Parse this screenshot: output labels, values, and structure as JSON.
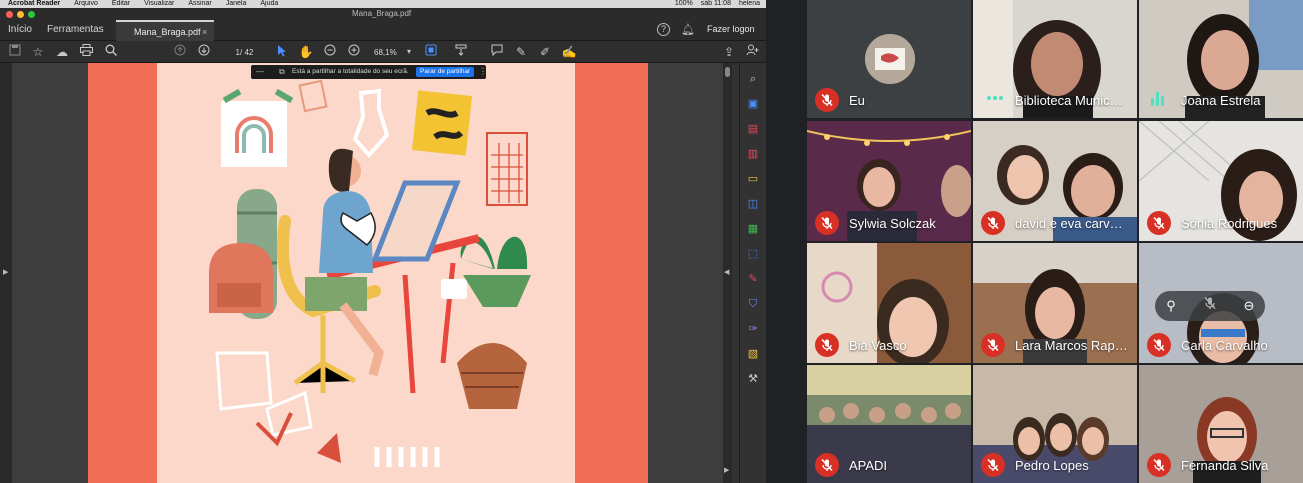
{
  "menubar": {
    "app": "Acrobat Reader",
    "items": [
      "Arquivo",
      "Editar",
      "Visualizar",
      "Assinar",
      "Janela",
      "Ajuda"
    ],
    "battery": "100%",
    "clock": "sáb 11:08",
    "user": "helena"
  },
  "window": {
    "title": "Mana_Braga.pdf",
    "nav_home": "Início",
    "nav_tools": "Ferramentas",
    "tab_label": "Mana_Braga.pdf",
    "tab_close": "×",
    "help_label": "?",
    "login_label": "Fazer logon"
  },
  "toolbar": {
    "page_current": "1",
    "page_total": "/ 42",
    "zoom": "68,1%"
  },
  "share_bar": {
    "message": "Está a partilhar a totalidade do seu ecrã.",
    "stop_label": "Parar de partilhar"
  },
  "participants": [
    {
      "name": "Eu"
    },
    {
      "name": "Biblioteca Munic…"
    },
    {
      "name": "Joana Estrela"
    },
    {
      "name": "Sylwia Solczak"
    },
    {
      "name": "david e eva carv…"
    },
    {
      "name": "Sónia Rodrigues"
    },
    {
      "name": "Bia Vasco"
    },
    {
      "name": "Lara Marcos Rap…"
    },
    {
      "name": "Carla Carvalho"
    },
    {
      "name": "APADI"
    },
    {
      "name": "Pedro Lopes"
    },
    {
      "name": "Fernanda Silva"
    }
  ],
  "colors": {
    "accent": "#1a73e8",
    "mute": "#d93025",
    "speaking": "#4ee0c0",
    "pdf_border": "#f26d55",
    "pdf_bg": "#fbd8c9"
  }
}
